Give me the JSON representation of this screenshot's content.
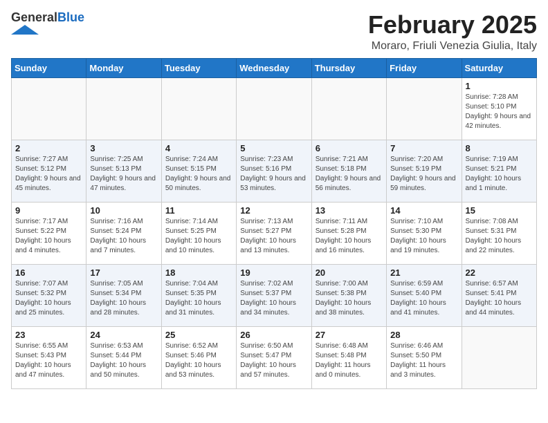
{
  "header": {
    "logo_general": "General",
    "logo_blue": "Blue",
    "month": "February 2025",
    "location": "Moraro, Friuli Venezia Giulia, Italy"
  },
  "weekdays": [
    "Sunday",
    "Monday",
    "Tuesday",
    "Wednesday",
    "Thursday",
    "Friday",
    "Saturday"
  ],
  "weeks": [
    [
      {
        "day": "",
        "info": ""
      },
      {
        "day": "",
        "info": ""
      },
      {
        "day": "",
        "info": ""
      },
      {
        "day": "",
        "info": ""
      },
      {
        "day": "",
        "info": ""
      },
      {
        "day": "",
        "info": ""
      },
      {
        "day": "1",
        "info": "Sunrise: 7:28 AM\nSunset: 5:10 PM\nDaylight: 9 hours and 42 minutes."
      }
    ],
    [
      {
        "day": "2",
        "info": "Sunrise: 7:27 AM\nSunset: 5:12 PM\nDaylight: 9 hours and 45 minutes."
      },
      {
        "day": "3",
        "info": "Sunrise: 7:25 AM\nSunset: 5:13 PM\nDaylight: 9 hours and 47 minutes."
      },
      {
        "day": "4",
        "info": "Sunrise: 7:24 AM\nSunset: 5:15 PM\nDaylight: 9 hours and 50 minutes."
      },
      {
        "day": "5",
        "info": "Sunrise: 7:23 AM\nSunset: 5:16 PM\nDaylight: 9 hours and 53 minutes."
      },
      {
        "day": "6",
        "info": "Sunrise: 7:21 AM\nSunset: 5:18 PM\nDaylight: 9 hours and 56 minutes."
      },
      {
        "day": "7",
        "info": "Sunrise: 7:20 AM\nSunset: 5:19 PM\nDaylight: 9 hours and 59 minutes."
      },
      {
        "day": "8",
        "info": "Sunrise: 7:19 AM\nSunset: 5:21 PM\nDaylight: 10 hours and 1 minute."
      }
    ],
    [
      {
        "day": "9",
        "info": "Sunrise: 7:17 AM\nSunset: 5:22 PM\nDaylight: 10 hours and 4 minutes."
      },
      {
        "day": "10",
        "info": "Sunrise: 7:16 AM\nSunset: 5:24 PM\nDaylight: 10 hours and 7 minutes."
      },
      {
        "day": "11",
        "info": "Sunrise: 7:14 AM\nSunset: 5:25 PM\nDaylight: 10 hours and 10 minutes."
      },
      {
        "day": "12",
        "info": "Sunrise: 7:13 AM\nSunset: 5:27 PM\nDaylight: 10 hours and 13 minutes."
      },
      {
        "day": "13",
        "info": "Sunrise: 7:11 AM\nSunset: 5:28 PM\nDaylight: 10 hours and 16 minutes."
      },
      {
        "day": "14",
        "info": "Sunrise: 7:10 AM\nSunset: 5:30 PM\nDaylight: 10 hours and 19 minutes."
      },
      {
        "day": "15",
        "info": "Sunrise: 7:08 AM\nSunset: 5:31 PM\nDaylight: 10 hours and 22 minutes."
      }
    ],
    [
      {
        "day": "16",
        "info": "Sunrise: 7:07 AM\nSunset: 5:32 PM\nDaylight: 10 hours and 25 minutes."
      },
      {
        "day": "17",
        "info": "Sunrise: 7:05 AM\nSunset: 5:34 PM\nDaylight: 10 hours and 28 minutes."
      },
      {
        "day": "18",
        "info": "Sunrise: 7:04 AM\nSunset: 5:35 PM\nDaylight: 10 hours and 31 minutes."
      },
      {
        "day": "19",
        "info": "Sunrise: 7:02 AM\nSunset: 5:37 PM\nDaylight: 10 hours and 34 minutes."
      },
      {
        "day": "20",
        "info": "Sunrise: 7:00 AM\nSunset: 5:38 PM\nDaylight: 10 hours and 38 minutes."
      },
      {
        "day": "21",
        "info": "Sunrise: 6:59 AM\nSunset: 5:40 PM\nDaylight: 10 hours and 41 minutes."
      },
      {
        "day": "22",
        "info": "Sunrise: 6:57 AM\nSunset: 5:41 PM\nDaylight: 10 hours and 44 minutes."
      }
    ],
    [
      {
        "day": "23",
        "info": "Sunrise: 6:55 AM\nSunset: 5:43 PM\nDaylight: 10 hours and 47 minutes."
      },
      {
        "day": "24",
        "info": "Sunrise: 6:53 AM\nSunset: 5:44 PM\nDaylight: 10 hours and 50 minutes."
      },
      {
        "day": "25",
        "info": "Sunrise: 6:52 AM\nSunset: 5:46 PM\nDaylight: 10 hours and 53 minutes."
      },
      {
        "day": "26",
        "info": "Sunrise: 6:50 AM\nSunset: 5:47 PM\nDaylight: 10 hours and 57 minutes."
      },
      {
        "day": "27",
        "info": "Sunrise: 6:48 AM\nSunset: 5:48 PM\nDaylight: 11 hours and 0 minutes."
      },
      {
        "day": "28",
        "info": "Sunrise: 6:46 AM\nSunset: 5:50 PM\nDaylight: 11 hours and 3 minutes."
      },
      {
        "day": "",
        "info": ""
      }
    ]
  ]
}
